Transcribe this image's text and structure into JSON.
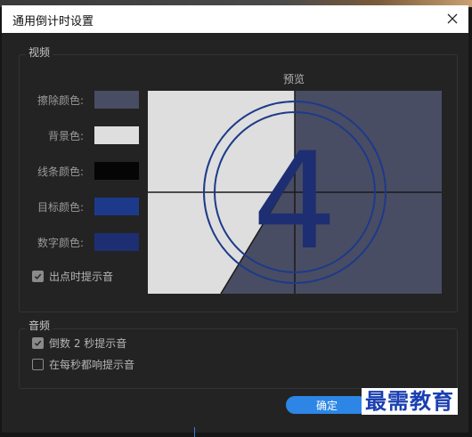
{
  "dialog": {
    "title": "通用倒计时设置"
  },
  "video": {
    "legend": "视频",
    "preview_label": "预览",
    "rows": [
      {
        "label": "擦除颜色:",
        "color": "#494d63"
      },
      {
        "label": "背景色:",
        "color": "#dedede"
      },
      {
        "label": "线条颜色:",
        "color": "#050505"
      },
      {
        "label": "目标颜色:",
        "color": "#1d3a8a"
      },
      {
        "label": "数字颜色:",
        "color": "#1e2e73"
      }
    ],
    "cue_checkbox": {
      "label": "出点时提示音",
      "checked": true
    },
    "preview_digit": "4"
  },
  "audio": {
    "legend": "音频",
    "checkboxes": [
      {
        "label": "倒数 2 秒提示音",
        "checked": true
      },
      {
        "label": "在每秒都响提示音",
        "checked": false
      }
    ]
  },
  "buttons": {
    "ok_label": "确定"
  },
  "watermark": "最需教育"
}
